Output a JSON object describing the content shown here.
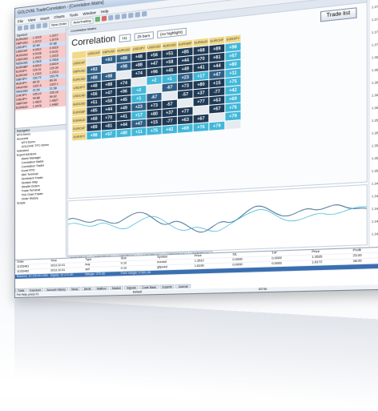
{
  "window": {
    "title": "GOLDVIE TradeCorrelation - [Correlation Matrix]"
  },
  "menu": [
    "File",
    "View",
    "Insert",
    "Charts",
    "Tools",
    "Window",
    "Help"
  ],
  "toolbar": {
    "new_order": "New Order",
    "autotrading": "AutoTrading"
  },
  "market_watch": {
    "header": "Symbol",
    "rows": [
      {
        "sym": "EURUSD",
        "bid": "1.3215",
        "ask": "1.3217",
        "hl": "red"
      },
      {
        "sym": "GBPUSD",
        "bid": "1.5712",
        "ask": "1.5715",
        "hl": "red"
      },
      {
        "sym": "USDJPY",
        "bid": "97.84",
        "ask": "97.86",
        "hl": "blue"
      },
      {
        "sym": "USDCHF",
        "bid": "0.9312",
        "ask": "0.9315",
        "hl": "red"
      },
      {
        "sym": "AUDUSD",
        "bid": "0.9128",
        "ask": "0.9131",
        "hl": "red"
      },
      {
        "sym": "USDCAD",
        "bid": "1.0312",
        "ask": "1.0315",
        "hl": "red"
      },
      {
        "sym": "NZDUSD",
        "bid": "0.7815",
        "ask": "0.7818",
        "hl": "blue"
      },
      {
        "sym": "EURGBP",
        "bid": "0.8412",
        "ask": "0.8414",
        "hl": "red"
      },
      {
        "sym": "EURJPY",
        "bid": "129.31",
        "ask": "129.34",
        "hl": "red"
      },
      {
        "sym": "EURCHF",
        "bid": "1.2310",
        "ask": "1.2313",
        "hl": "red"
      },
      {
        "sym": "GBPJPY",
        "bid": "153.72",
        "ask": "153.76",
        "hl": "blue"
      },
      {
        "sym": "AUDJPY",
        "bid": "89.31",
        "ask": "89.34",
        "hl": "red"
      },
      {
        "sym": "XAUUSD",
        "bid": "1321.5",
        "ask": "1322.1",
        "hl": "red"
      },
      {
        "sym": "XAGUSD",
        "bid": "21.54",
        "ask": "21.58",
        "hl": "blue"
      },
      {
        "sym": "CHFJPY",
        "bid": "105.12",
        "ask": "105.16",
        "hl": "red"
      },
      {
        "sym": "CADJPY",
        "bid": "94.88",
        "ask": "94.92",
        "hl": "red"
      },
      {
        "sym": "GBPCHF",
        "bid": "1.4623",
        "ask": "1.4627",
        "hl": "red"
      },
      {
        "sym": "EURAUD",
        "bid": "1.4478",
        "ask": "1.4482",
        "hl": "red"
      }
    ],
    "tabs": [
      "Symbols",
      "Tick Chart"
    ]
  },
  "navigator": {
    "header": "Navigator",
    "items": [
      "MT4 Demo",
      "Accounts",
      "MT4 Demo",
      "GOLDVIE TFC-Demo",
      "Indicators",
      "Expert Advisors",
      "Alarm Manager",
      "Correlation Matrix",
      "Correlation Trader",
      "Excel RTD",
      "Mini Terminal",
      "Sentiment Trader",
      "Session Map",
      "Stealth Orders",
      "Trade Terminal",
      "Tick Chart Trader",
      "Order History",
      "Scripts"
    ],
    "tabs": [
      "Common",
      "Favorites"
    ]
  },
  "correlation": {
    "window_title": "Correlation Matrix",
    "title": "Correlation",
    "timeframe": "H1",
    "bars": "25 bars",
    "highlight": "(no highlight)",
    "trade_list": "Trade list",
    "symbols": [
      "USDCHF",
      "GBPUSD",
      "EURUSD",
      "USDJPY",
      "USDCAD",
      "AUDUSD",
      "EURGBP",
      "EURAUD",
      "EURCHF",
      "EURJPY"
    ],
    "rows": [
      {
        "sym": "USDCHF",
        "cells": [
          {
            "v": "",
            "c": "empty"
          },
          {
            "v": "+93",
            "c": "mid"
          },
          {
            "v": "+88",
            "c": "mid"
          },
          {
            "v": "+48",
            "c": "dark"
          },
          {
            "v": "+56",
            "c": "dark"
          },
          {
            "v": "+51",
            "c": "dark"
          },
          {
            "v": "+85",
            "c": "dark"
          },
          {
            "v": "+68",
            "c": "dark"
          },
          {
            "v": "+89",
            "c": "dark"
          },
          {
            "v": "+98",
            "c": "light"
          }
        ]
      },
      {
        "sym": "GBPUSD",
        "cells": [
          {
            "v": "+93",
            "c": "mid"
          },
          {
            "v": "",
            "c": "empty"
          },
          {
            "v": "+98",
            "c": "mid"
          },
          {
            "v": "+88",
            "c": "dark"
          },
          {
            "v": "+47",
            "c": "dark"
          },
          {
            "v": "+58",
            "c": "dark"
          },
          {
            "v": "+44",
            "c": "dark"
          },
          {
            "v": "+70",
            "c": "dark"
          },
          {
            "v": "+81",
            "c": "dark"
          },
          {
            "v": "+57",
            "c": "light"
          }
        ]
      },
      {
        "sym": "EURUSD",
        "cells": [
          {
            "v": "+88",
            "c": "mid"
          },
          {
            "v": "+98",
            "c": "mid"
          },
          {
            "v": "",
            "c": "empty"
          },
          {
            "v": "+74",
            "c": "dark"
          },
          {
            "v": "+96",
            "c": "dark"
          },
          {
            "v": "+45",
            "c": "dark"
          },
          {
            "v": "+49",
            "c": "dark"
          },
          {
            "v": "+41",
            "c": "dark"
          },
          {
            "v": "+44",
            "c": "dark"
          },
          {
            "v": "+80",
            "c": "light"
          }
        ]
      },
      {
        "sym": "USDJPY",
        "cells": [
          {
            "v": "+48",
            "c": "dark"
          },
          {
            "v": "+88",
            "c": "dark"
          },
          {
            "v": "+74",
            "c": "dark"
          },
          {
            "v": "",
            "c": "empty"
          },
          {
            "v": "+2",
            "c": "light"
          },
          {
            "v": "+1",
            "c": "light"
          },
          {
            "v": "+23",
            "c": "mid"
          },
          {
            "v": "+17",
            "c": "light"
          },
          {
            "v": "+47",
            "c": "mid"
          },
          {
            "v": "+11",
            "c": "light"
          }
        ]
      },
      {
        "sym": "USDCAD",
        "cells": [
          {
            "v": "+56",
            "c": "dark"
          },
          {
            "v": "+47",
            "c": "dark"
          },
          {
            "v": "+96",
            "c": "dark"
          },
          {
            "v": "+2",
            "c": "light"
          },
          {
            "v": "",
            "c": "empty"
          },
          {
            "v": "-67",
            "c": "mid"
          },
          {
            "v": "+73",
            "c": "dark"
          },
          {
            "v": "+80",
            "c": "dark"
          },
          {
            "v": "+15",
            "c": "dark"
          },
          {
            "v": "+75",
            "c": "light"
          }
        ]
      },
      {
        "sym": "AUDUSD",
        "cells": [
          {
            "v": "+51",
            "c": "dark"
          },
          {
            "v": "+58",
            "c": "dark"
          },
          {
            "v": "+45",
            "c": "dark"
          },
          {
            "v": "+1",
            "c": "light"
          },
          {
            "v": "-67",
            "c": "mid"
          },
          {
            "v": "",
            "c": "empty"
          },
          {
            "v": "-57",
            "c": "dark"
          },
          {
            "v": "+37",
            "c": "dark"
          },
          {
            "v": "-77",
            "c": "dark"
          },
          {
            "v": "+42",
            "c": "light"
          }
        ]
      },
      {
        "sym": "EURGBP",
        "cells": [
          {
            "v": "+85",
            "c": "dark"
          },
          {
            "v": "+44",
            "c": "dark"
          },
          {
            "v": "+49",
            "c": "dark"
          },
          {
            "v": "+23",
            "c": "mid"
          },
          {
            "v": "+73",
            "c": "dark"
          },
          {
            "v": "-57",
            "c": "dark"
          },
          {
            "v": "",
            "c": "empty"
          },
          {
            "v": "+77",
            "c": "dark"
          },
          {
            "v": "+63",
            "c": "dark"
          },
          {
            "v": "+69",
            "c": "light"
          }
        ]
      },
      {
        "sym": "EURAUD",
        "cells": [
          {
            "v": "+68",
            "c": "dark"
          },
          {
            "v": "+70",
            "c": "dark"
          },
          {
            "v": "+41",
            "c": "dark"
          },
          {
            "v": "+17",
            "c": "light"
          },
          {
            "v": "+80",
            "c": "dark"
          },
          {
            "v": "+37",
            "c": "dark"
          },
          {
            "v": "+77",
            "c": "dark"
          },
          {
            "v": "",
            "c": "empty"
          },
          {
            "v": "+67",
            "c": "dark"
          },
          {
            "v": "+76",
            "c": "light"
          }
        ]
      },
      {
        "sym": "EURCHF",
        "cells": [
          {
            "v": "+89",
            "c": "dark"
          },
          {
            "v": "+81",
            "c": "dark"
          },
          {
            "v": "+44",
            "c": "dark"
          },
          {
            "v": "+47",
            "c": "mid"
          },
          {
            "v": "+15",
            "c": "dark"
          },
          {
            "v": "-77",
            "c": "dark"
          },
          {
            "v": "+63",
            "c": "dark"
          },
          {
            "v": "+67",
            "c": "dark"
          },
          {
            "v": "",
            "c": "empty"
          },
          {
            "v": "+79",
            "c": "light"
          }
        ]
      },
      {
        "sym": "EURJPY",
        "cells": [
          {
            "v": "+98",
            "c": "light"
          },
          {
            "v": "+57",
            "c": "light"
          },
          {
            "v": "+80",
            "c": "light"
          },
          {
            "v": "+11",
            "c": "light"
          },
          {
            "v": "+75",
            "c": "light"
          },
          {
            "v": "+42",
            "c": "light"
          },
          {
            "v": "+69",
            "c": "light"
          },
          {
            "v": "+76",
            "c": "light"
          },
          {
            "v": "+79",
            "c": "light"
          },
          {
            "v": "",
            "c": "empty"
          }
        ]
      }
    ]
  },
  "price_scale": [
    "1.3780",
    "1.3760",
    "1.3740",
    "1.3720",
    "1.3700",
    "1.3680",
    "1.3660",
    "1.3640",
    "1.3620",
    "1.3600",
    "1.3580",
    "1.3560",
    "1.3540",
    "1.3520",
    "1.3500",
    "1.3480",
    "1.3460",
    "1.3440",
    "1.3420",
    "1.3400"
  ],
  "chart_tabs": [
    "EURUSD,H1",
    "GBPUSD,H1",
    "USDJPY,H1",
    "AUDUSD,H1",
    "USDCAD,H1",
    "EURJPY,H1"
  ],
  "terminal": {
    "columns": [
      "Order",
      "Time",
      "Type",
      "Size",
      "Symbol",
      "Price",
      "S/L",
      "T/P",
      "Price",
      "Profit"
    ],
    "rows": [
      [
        "11253461",
        "2013.10.01",
        "buy",
        "0.10",
        "eurusd",
        "1.3512",
        "0.0000",
        "0.0000",
        "1.3535",
        "23.00"
      ],
      [
        "11253462",
        "2013.10.01",
        "sell",
        "0.10",
        "gbpusd",
        "1.6190",
        "0.0000",
        "0.0000",
        "1.6172",
        "18.00"
      ],
      [
        "Balance: 10 130.00 USD",
        "Equity: 10 171.00",
        "Margin: 270.00",
        "Free margin: 9 901.00",
        "",
        "",
        "",
        "",
        "",
        ""
      ]
    ],
    "tabs": [
      "Trade",
      "Exposure",
      "Account History",
      "News",
      "Alerts",
      "Mailbox",
      "Market",
      "Signals",
      "Code Base",
      "Experts",
      "Journal"
    ]
  },
  "status": {
    "help": "For Help, press F1",
    "profile": "Default",
    "traffic": "4/2 kb"
  },
  "colors": {
    "dark": "#1f3a55",
    "mid": "#2f5f86",
    "light": "#42b7d8",
    "header": "#f0d98a"
  }
}
